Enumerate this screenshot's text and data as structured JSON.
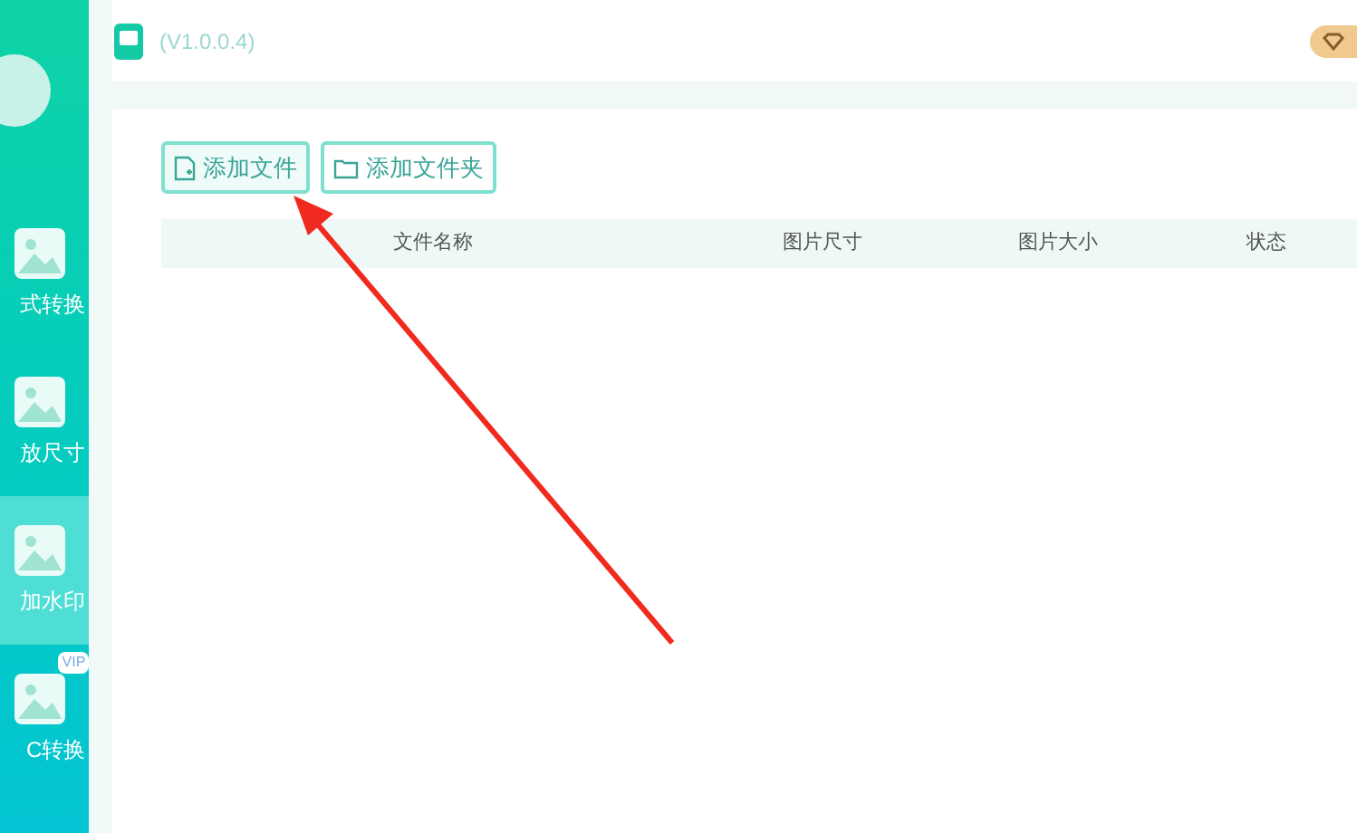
{
  "window": {
    "title": "(V1.0.0.4)"
  },
  "sidebar": {
    "items": [
      {
        "label": "式转换",
        "selected": false
      },
      {
        "label": "放尺寸",
        "selected": false
      },
      {
        "label": "加水印",
        "selected": true
      },
      {
        "label": "C转换",
        "selected": false,
        "badge": "VIP"
      }
    ]
  },
  "toolbar": {
    "buttons": [
      {
        "label": "添加文件",
        "kind": "file"
      },
      {
        "label": "添加文件夹",
        "kind": "folder"
      }
    ]
  },
  "table": {
    "columns": [
      "文件名称",
      "图片尺寸",
      "图片大小",
      "状态"
    ]
  }
}
